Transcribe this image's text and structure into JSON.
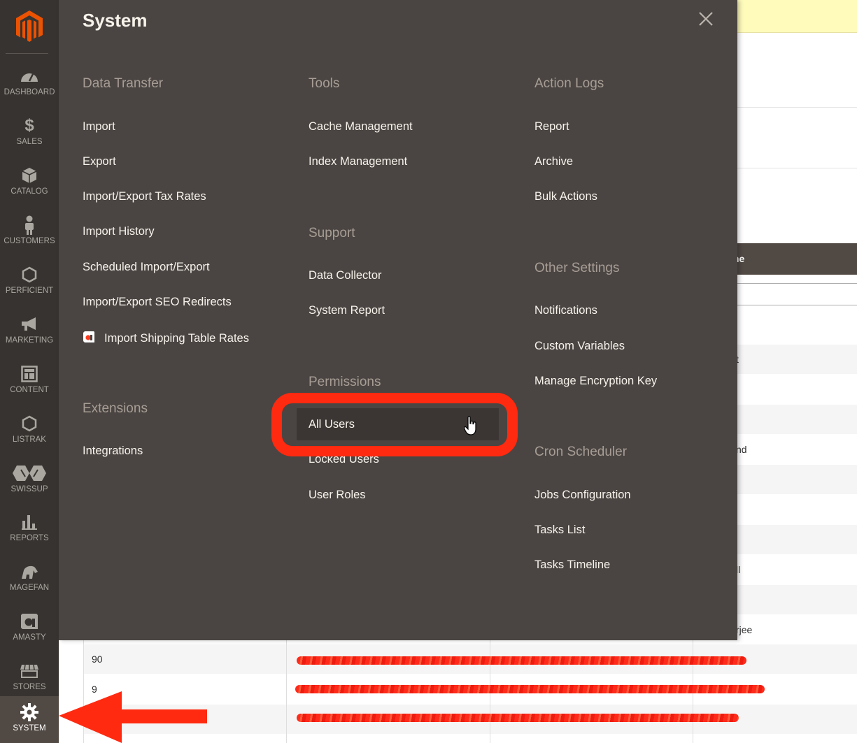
{
  "sidebar": {
    "items": [
      {
        "label": "DASHBOARD",
        "icon": "dashboard-icon"
      },
      {
        "label": "SALES",
        "icon": "dollar-icon"
      },
      {
        "label": "CATALOG",
        "icon": "box-icon"
      },
      {
        "label": "CUSTOMERS",
        "icon": "person-icon"
      },
      {
        "label": "PERFICIENT",
        "icon": "hexagon-icon"
      },
      {
        "label": "MARKETING",
        "icon": "megaphone-icon"
      },
      {
        "label": "CONTENT",
        "icon": "layout-icon"
      },
      {
        "label": "LISTRAK",
        "icon": "hexagon-icon"
      },
      {
        "label": "SWISSUP",
        "icon": "swissup-icon"
      },
      {
        "label": "REPORTS",
        "icon": "bar-chart-icon"
      },
      {
        "label": "MAGEFAN",
        "icon": "magefan-icon"
      },
      {
        "label": "AMASTY",
        "icon": "amasty-icon"
      },
      {
        "label": "STORES",
        "icon": "store-icon"
      },
      {
        "label": "SYSTEM",
        "icon": "gear-icon"
      }
    ],
    "active": "SYSTEM"
  },
  "flyout": {
    "title": "System",
    "columns": [
      {
        "sections": [
          {
            "title": "Data Transfer",
            "links": [
              "Import",
              "Export",
              "Import/Export Tax Rates",
              "Import History",
              "Scheduled Import/Export",
              "Import/Export SEO Redirects",
              "Import Shipping Table Rates"
            ]
          },
          {
            "title": "Extensions",
            "links": [
              "Integrations"
            ]
          }
        ]
      },
      {
        "sections": [
          {
            "title": "Tools",
            "links": [
              "Cache Management",
              "Index Management"
            ]
          },
          {
            "title": "Support",
            "links": [
              "Data Collector",
              "System Report"
            ]
          },
          {
            "title": "Permissions",
            "links": [
              "All Users",
              "Locked Users",
              "User Roles"
            ]
          }
        ]
      },
      {
        "sections": [
          {
            "title": "Action Logs",
            "links": [
              "Report",
              "Archive",
              "Bulk Actions"
            ]
          },
          {
            "title": "Other Settings",
            "links": [
              "Notifications",
              "Custom Variables",
              "Manage Encryption Key"
            ]
          },
          {
            "title": "Cron Scheduler",
            "links": [
              "Jobs Configuration",
              "Tasks List",
              "Tasks Timeline"
            ]
          }
        ]
      }
    ]
  },
  "background": {
    "header_fragment": "me",
    "row_fragments": [
      "t",
      "nd",
      "ll",
      "rjee"
    ],
    "table_ids": [
      "90",
      "9"
    ]
  },
  "colors": {
    "sidebar_bg": "#373330",
    "flyout_bg": "#4a4542",
    "annotation_red": "#ff2a10",
    "magento_orange": "#eb5202"
  }
}
